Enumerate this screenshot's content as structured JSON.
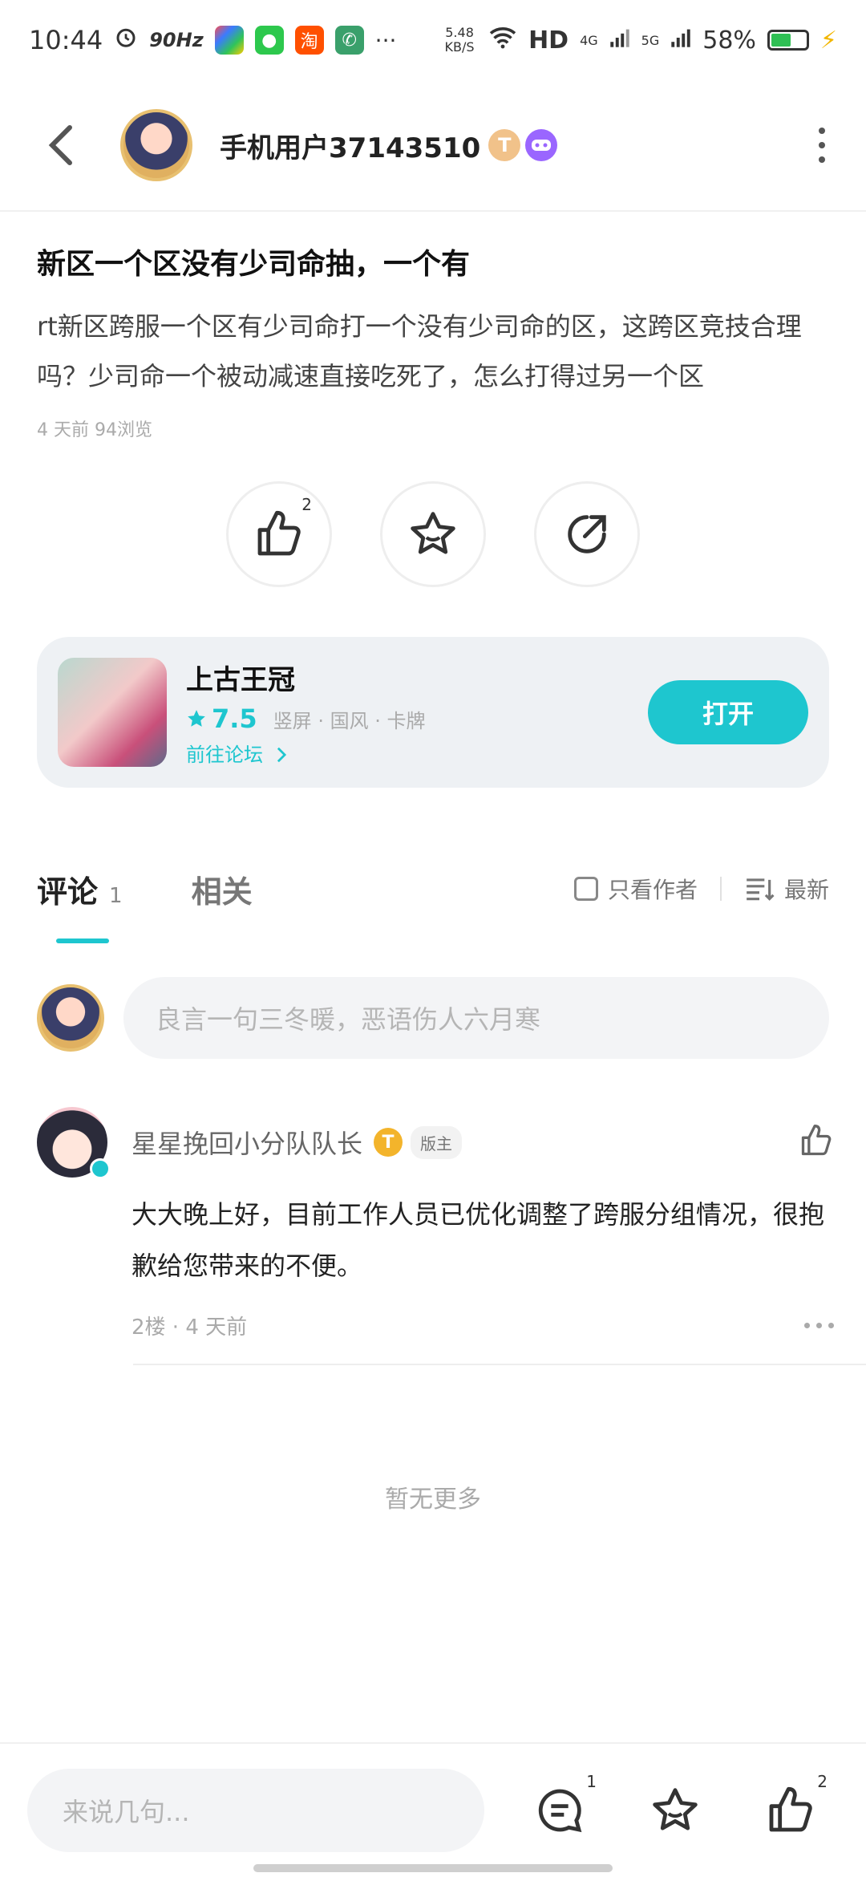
{
  "status_bar": {
    "time": "10:44",
    "refresh_rate": "90Hz",
    "network_speed": "5.48 KB/S",
    "hd": "HD",
    "signal_4g": "4G",
    "signal_5g": "5G",
    "battery_percent": "58%",
    "battery_level": 0.58,
    "more": "···",
    "apps": [
      "taobao-icon"
    ]
  },
  "header": {
    "username": "手机用户37143510",
    "level_badge": "T"
  },
  "post": {
    "title": "新区一个区没有少司命抽，一个有",
    "body": "rt新区跨服一个区有少司命打一个没有少司命的区，这跨区竞技合理吗？少司命一个被动减速直接吃死了，怎么打得过另一个区",
    "meta": "4 天前  94浏览"
  },
  "actions": {
    "like_count": "2"
  },
  "game_card": {
    "name": "上古王冠",
    "rating": "7.5",
    "tags": "竖屏 · 国风 · 卡牌",
    "forum_link": "前往论坛",
    "open_label": "打开"
  },
  "tabs": {
    "comments_label": "评论",
    "comments_count": "1",
    "related_label": "相关",
    "author_only_label": "只看作者",
    "sort_label": "最新"
  },
  "comment_input": {
    "placeholder": "良言一句三冬暖，恶语伤人六月寒"
  },
  "comments": [
    {
      "author": "星星挽回小分队队长",
      "badge": "T",
      "role": "版主",
      "body": "大大晚上好，目前工作人员已优化调整了跨服分组情况，很抱歉给您带来的不便。",
      "meta": "2楼 · 4 天前"
    }
  ],
  "no_more": "暂无更多",
  "bottom_bar": {
    "reply_placeholder": "来说几句...",
    "comment_count": "1",
    "like_count": "2"
  },
  "colors": {
    "accent": "#1ec6cf",
    "card_bg": "#eef1f4"
  }
}
